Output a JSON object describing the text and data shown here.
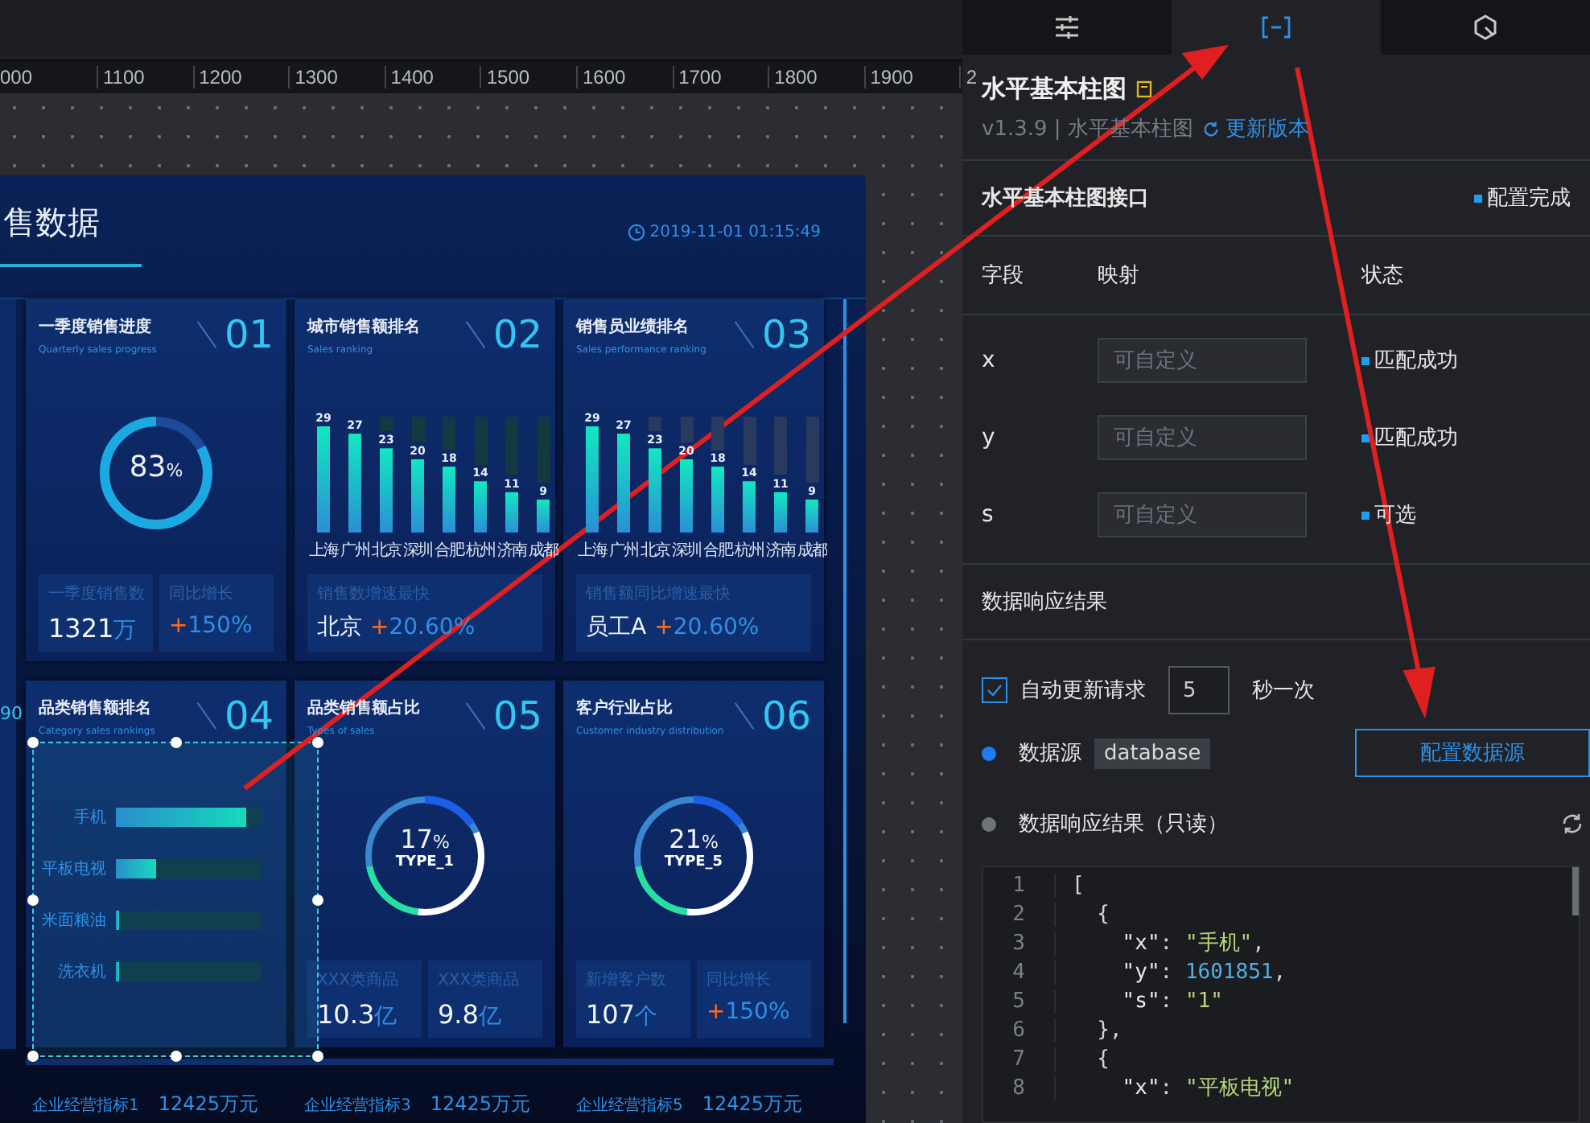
{
  "ruler": {
    "labels": [
      "000",
      "1100",
      "1200",
      "1300",
      "1400",
      "1500",
      "1600",
      "1700",
      "1800",
      "1900",
      "2"
    ]
  },
  "dashboard": {
    "title": "售数据",
    "timestamp": "2019-11-01 01:15:49",
    "edge_label": "90",
    "cards": [
      {
        "kind": "progress",
        "title": "一季度销售进度",
        "subtitle": "Quarterly sales progress",
        "number": "01",
        "level": 0.83,
        "reading": "83",
        "reading_unit": "%",
        "stats": [
          {
            "label": "一季度销售数",
            "value": "1321",
            "unit": "万"
          },
          {
            "label": "同比增长",
            "sign": "+",
            "change": "150%"
          }
        ]
      },
      {
        "kind": "bars",
        "title": "城市销售额排名",
        "subtitle": "Sales ranking",
        "number": "02",
        "chart_data": {
          "type": "bar",
          "categories": [
            "上海",
            "广州",
            "北京",
            "深圳",
            "合肥",
            "杭州",
            "济南",
            "成都"
          ],
          "values": [
            29,
            27,
            23,
            20,
            18,
            14,
            11,
            9
          ],
          "data_labels": true
        },
        "stats": [
          {
            "label": "销售数增速最快",
            "name": "北京",
            "sign": "+",
            "change": "20.60%"
          }
        ]
      },
      {
        "kind": "bars",
        "title": "销售员业绩排名",
        "subtitle": "Sales performance ranking",
        "number": "03",
        "chart_data": {
          "type": "bar",
          "categories": [
            "上海",
            "广州",
            "北京",
            "深圳",
            "合肥",
            "杭州",
            "济南",
            "成都"
          ],
          "values": [
            29,
            27,
            23,
            20,
            18,
            14,
            11,
            9
          ],
          "data_labels": true
        },
        "stats": [
          {
            "label": "销售额同比增速最快",
            "name": "员工A",
            "sign": "+",
            "change": "20.60%"
          }
        ]
      },
      {
        "kind": "hbars",
        "title": "品类销售额排名",
        "subtitle": "Category sales rankings",
        "number": "04",
        "items": [
          {
            "label": "手机",
            "level": 0.9
          },
          {
            "label": "平板电视",
            "level": 0.28
          },
          {
            "label": "米面粮油",
            "level": 0.02
          },
          {
            "label": "洗衣机",
            "level": 0.02
          }
        ]
      },
      {
        "kind": "donut",
        "title": "品类销售额占比",
        "subtitle": "Types of sales",
        "number": "05",
        "reading": "17",
        "reading_unit": "%",
        "center_label": "TYPE_1",
        "stats": [
          {
            "label": "XXX类商品",
            "value": "10.3",
            "unit": "亿"
          },
          {
            "label": "XXX类商品",
            "value": "9.8",
            "unit": "亿"
          }
        ]
      },
      {
        "kind": "donut",
        "title": "客户行业占比",
        "subtitle": "Customer industry distribution",
        "number": "06",
        "reading": "21",
        "reading_unit": "%",
        "center_label": "TYPE_5",
        "stats": [
          {
            "label": "新增客户数",
            "value": "107",
            "unit": "个"
          },
          {
            "label": "同比增长",
            "sign": "+",
            "change": "150%"
          }
        ]
      }
    ],
    "footer_metrics": [
      {
        "label": "企业经营指标1",
        "value": "12425万元"
      },
      {
        "label": "企业经营指标3",
        "value": "12425万元"
      },
      {
        "label": "企业经营指标5",
        "value": "12425万元"
      }
    ]
  },
  "panel": {
    "tabs": [
      {
        "kind": "sliders",
        "selected": false
      },
      {
        "kind": "brackets",
        "selected": true
      },
      {
        "kind": "hexagon",
        "selected": false
      }
    ],
    "title": "水平基本柱图",
    "version": "v1.3.9 | 水平基本柱图",
    "update_link": "更新版本",
    "interface": {
      "title": "水平基本柱图接口",
      "status": "配置完成",
      "columns": [
        "字段",
        "映射",
        "状态"
      ],
      "fields": [
        {
          "name": "x",
          "placeholder": "可自定义",
          "status": "匹配成功"
        },
        {
          "name": "y",
          "placeholder": "可自定义",
          "status": "匹配成功"
        },
        {
          "name": "s",
          "placeholder": "可自定义",
          "status": "可选"
        }
      ]
    },
    "response": {
      "title": "数据响应结果",
      "auto_update": {
        "checked": true,
        "label": "自动更新请求",
        "interval": "5",
        "suffix": "秒一次"
      },
      "steps": [
        {
          "kind": "source",
          "active": true,
          "label": "数据源",
          "tag": "database",
          "button": "配置数据源"
        },
        {
          "kind": "result",
          "active": false,
          "label": "数据响应结果（只读）"
        }
      ],
      "code": [
        {
          "n": "1",
          "tokens": [
            {
              "t": "[",
              "kind": "punct"
            }
          ]
        },
        {
          "n": "2",
          "tokens": [
            {
              "t": "  {",
              "kind": "punct"
            }
          ]
        },
        {
          "n": "3",
          "tokens": [
            {
              "t": "    \"x\"",
              "kind": "key"
            },
            {
              "t": ": ",
              "kind": "punct"
            },
            {
              "t": "\"手机\"",
              "kind": "string"
            },
            {
              "t": ",",
              "kind": "punct"
            }
          ]
        },
        {
          "n": "4",
          "tokens": [
            {
              "t": "    \"y\"",
              "kind": "key"
            },
            {
              "t": ": ",
              "kind": "punct"
            },
            {
              "t": "1601851",
              "kind": "number"
            },
            {
              "t": ",",
              "kind": "punct"
            }
          ]
        },
        {
          "n": "5",
          "tokens": [
            {
              "t": "    \"s\"",
              "kind": "key"
            },
            {
              "t": ": ",
              "kind": "punct"
            },
            {
              "t": "\"1\"",
              "kind": "string"
            }
          ]
        },
        {
          "n": "6",
          "tokens": [
            {
              "t": "  },",
              "kind": "punct"
            }
          ]
        },
        {
          "n": "7",
          "tokens": [
            {
              "t": "  {",
              "kind": "punct"
            }
          ]
        },
        {
          "n": "8",
          "tokens": [
            {
              "t": "    \"x\"",
              "kind": "key"
            },
            {
              "t": ": ",
              "kind": "punct"
            },
            {
              "t": "\"平板电视\"",
              "kind": "string"
            }
          ]
        }
      ]
    }
  }
}
